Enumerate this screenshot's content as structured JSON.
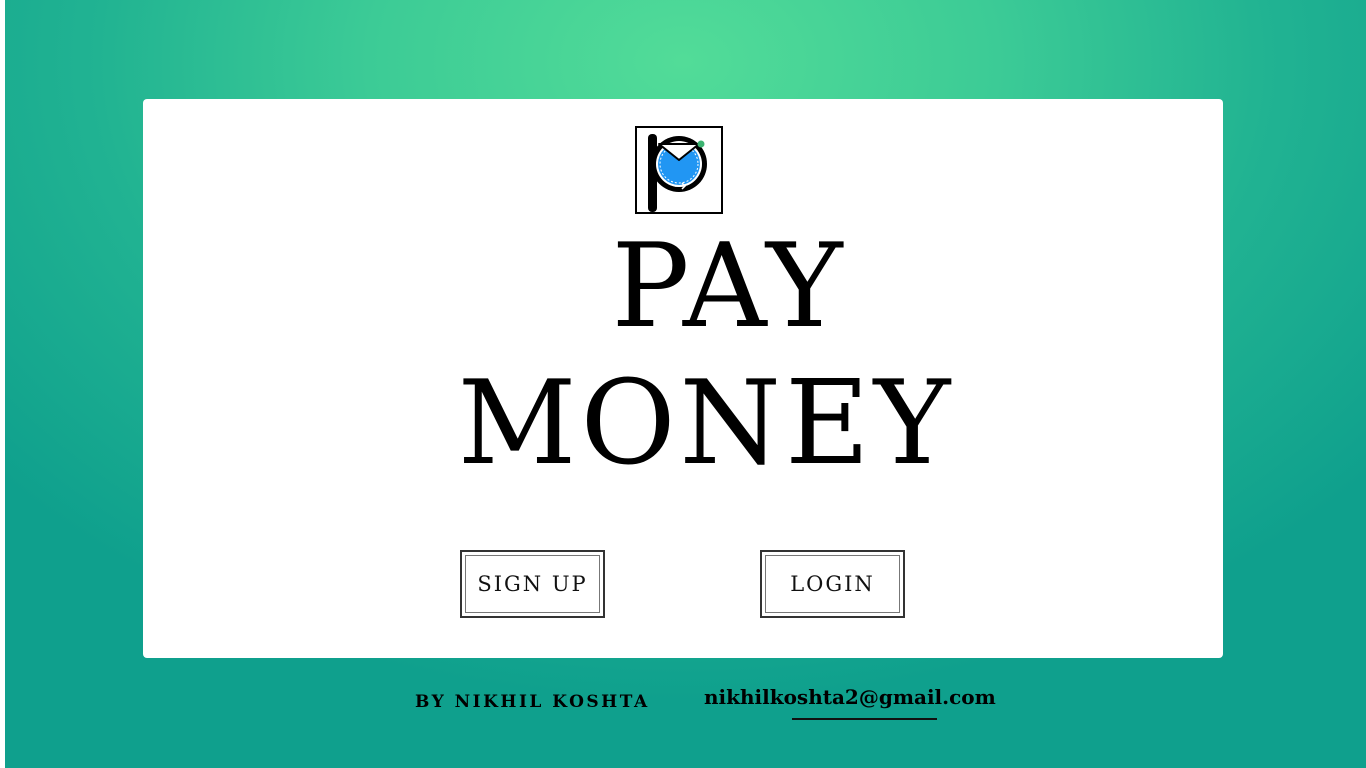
{
  "brand": {
    "logo_icon": "pay-money-logo",
    "title_line1": "PAY",
    "title_line2": "MONEY",
    "accent_color": "#2196f3"
  },
  "actions": {
    "signup_label": "SIGN UP",
    "login_label": "LOGIN"
  },
  "footer": {
    "author": "BY NIKHIL KOSHTA",
    "email": "nikhilkoshta2@gmail.com"
  },
  "colors": {
    "background_light": "#52dc98",
    "background_dark": "#0fa08d",
    "card": "#ffffff",
    "text": "#000000"
  }
}
